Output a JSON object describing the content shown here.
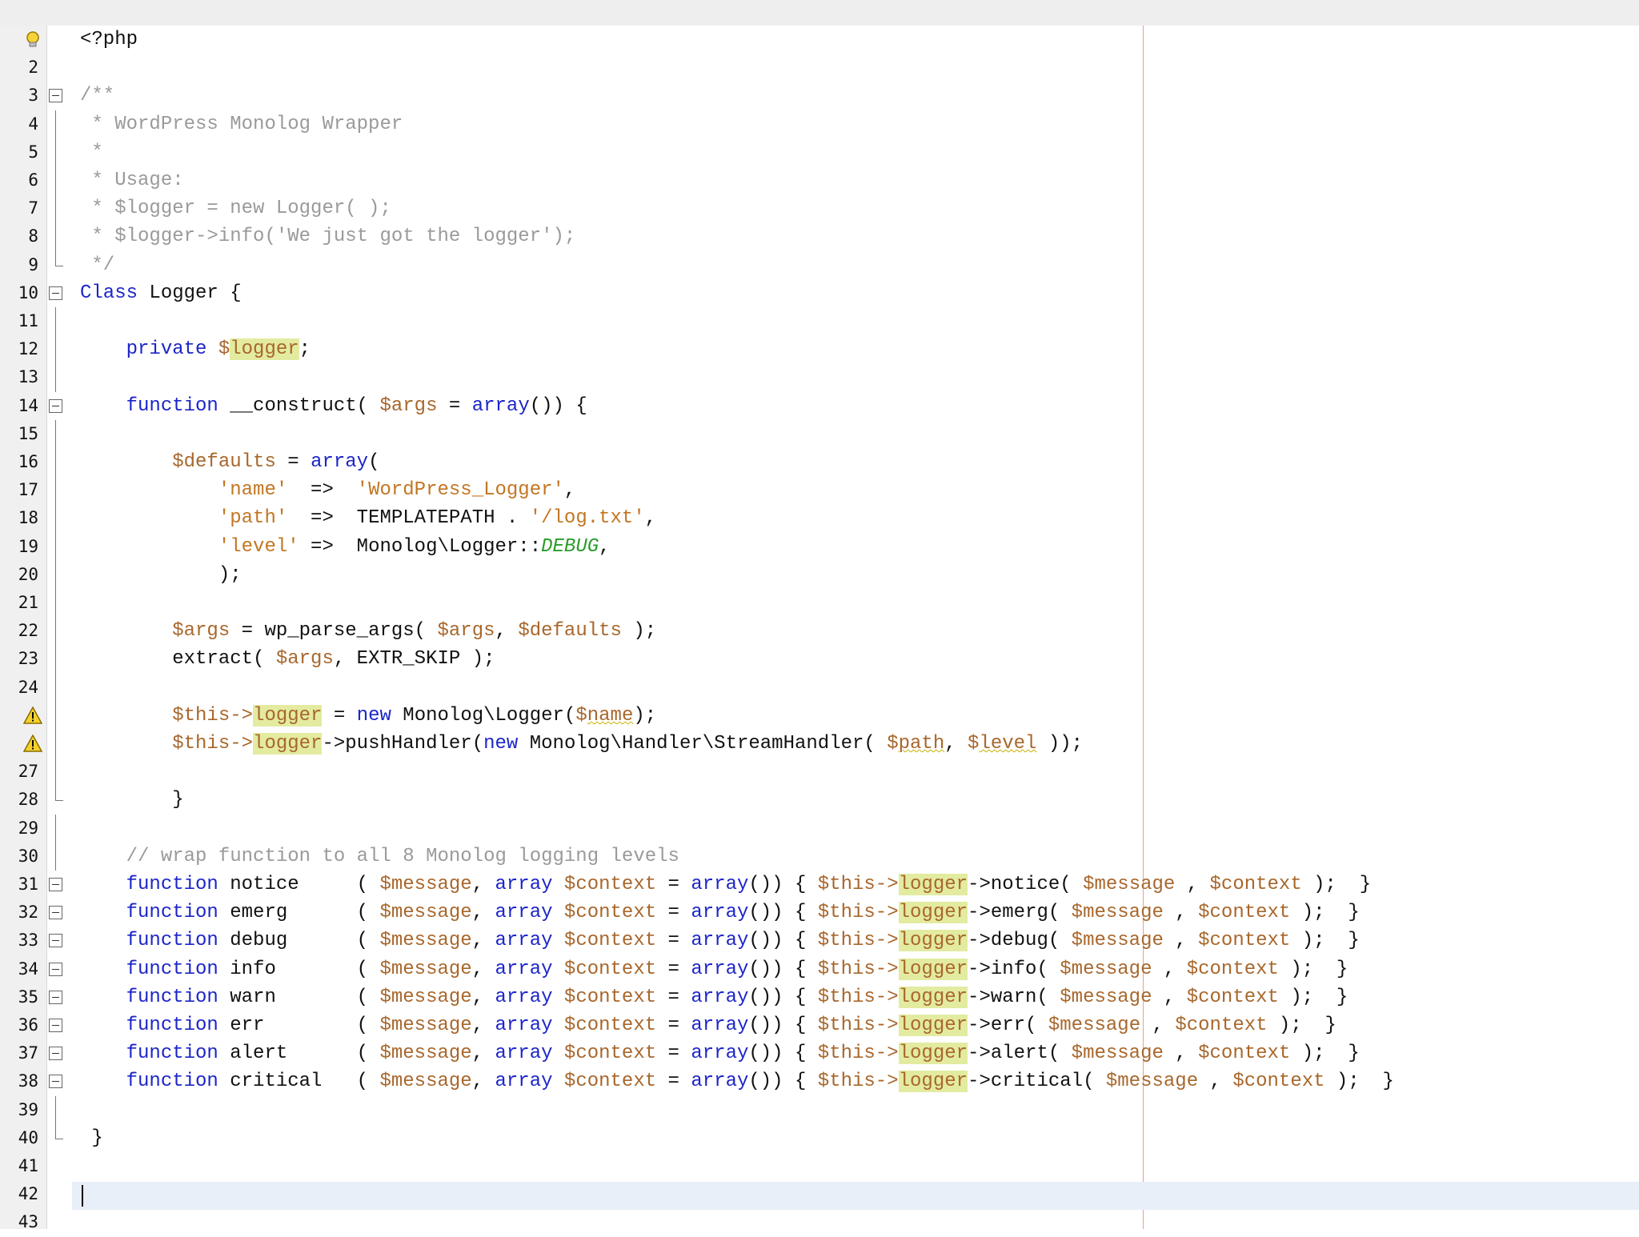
{
  "editor": {
    "colors": {
      "background": "#ffffff",
      "gutter": "#f0f0f0",
      "keyword": "#1c25c8",
      "variable": "#a8672c",
      "string": "#c27622",
      "comment": "#9a9a9a",
      "constant": "#2a9d2a",
      "highlight": "#e3eba0",
      "margin_line": "#f19b8c",
      "current_line": "#e9eff8"
    },
    "lines": [
      {
        "n": "1",
        "icon": "bulb",
        "tokens": [
          [
            "<?php",
            ""
          ]
        ]
      },
      {
        "n": "2",
        "tokens": []
      },
      {
        "n": "3",
        "fold": "start",
        "tokens": [
          [
            "/**",
            "cm"
          ]
        ]
      },
      {
        "n": "4",
        "fold": "line",
        "tokens": [
          [
            " * WordPress Monolog Wrapper",
            "cm"
          ]
        ]
      },
      {
        "n": "5",
        "fold": "line",
        "tokens": [
          [
            " *",
            "cm"
          ]
        ]
      },
      {
        "n": "6",
        "fold": "line",
        "tokens": [
          [
            " * Usage:",
            "cm"
          ]
        ]
      },
      {
        "n": "7",
        "fold": "line",
        "tokens": [
          [
            " * $logger = new Logger( );",
            "cm"
          ]
        ]
      },
      {
        "n": "8",
        "fold": "line",
        "tokens": [
          [
            " * $logger->info('We just got the logger');",
            "cm"
          ]
        ]
      },
      {
        "n": "9",
        "fold": "end",
        "tokens": [
          [
            " */",
            "cm"
          ]
        ]
      },
      {
        "n": "10",
        "fold": "start",
        "tokens": [
          [
            "Class",
            "kw"
          ],
          [
            " Logger {",
            ""
          ]
        ]
      },
      {
        "n": "11",
        "fold": "line",
        "tokens": []
      },
      {
        "n": "12",
        "fold": "line",
        "tokens": [
          [
            "    ",
            ""
          ],
          [
            "private",
            "kw"
          ],
          [
            " ",
            ""
          ],
          [
            "$",
            "var"
          ],
          [
            "logger",
            "var hl"
          ],
          [
            ";",
            ""
          ]
        ]
      },
      {
        "n": "13",
        "fold": "line",
        "tokens": []
      },
      {
        "n": "14",
        "fold": "start",
        "tokens": [
          [
            "    ",
            ""
          ],
          [
            "function",
            "kw"
          ],
          [
            " __construct( ",
            ""
          ],
          [
            "$args",
            "var"
          ],
          [
            " = ",
            ""
          ],
          [
            "array",
            "kw"
          ],
          [
            "()) {",
            ""
          ]
        ]
      },
      {
        "n": "15",
        "fold": "line",
        "tokens": []
      },
      {
        "n": "16",
        "fold": "line",
        "tokens": [
          [
            "        ",
            ""
          ],
          [
            "$defaults",
            "var"
          ],
          [
            " = ",
            ""
          ],
          [
            "array",
            "kw"
          ],
          [
            "(",
            ""
          ]
        ]
      },
      {
        "n": "17",
        "fold": "line",
        "tokens": [
          [
            "            ",
            ""
          ],
          [
            "'name'",
            "str"
          ],
          [
            "  =>  ",
            ""
          ],
          [
            "'WordPress_Logger'",
            "str"
          ],
          [
            ",",
            ""
          ]
        ]
      },
      {
        "n": "18",
        "fold": "line",
        "tokens": [
          [
            "            ",
            ""
          ],
          [
            "'path'",
            "str"
          ],
          [
            "  =>  TEMPLATEPATH . ",
            ""
          ],
          [
            "'/log.txt'",
            "str"
          ],
          [
            ",",
            ""
          ]
        ]
      },
      {
        "n": "19",
        "fold": "line",
        "tokens": [
          [
            "            ",
            ""
          ],
          [
            "'level'",
            "str"
          ],
          [
            " =>  Monolog\\Logger::",
            ""
          ],
          [
            "DEBUG",
            "const-it"
          ],
          [
            ",",
            ""
          ]
        ]
      },
      {
        "n": "20",
        "fold": "line",
        "tokens": [
          [
            "            );",
            ""
          ]
        ]
      },
      {
        "n": "21",
        "fold": "line",
        "tokens": []
      },
      {
        "n": "22",
        "fold": "line",
        "tokens": [
          [
            "        ",
            ""
          ],
          [
            "$args",
            "var"
          ],
          [
            " = wp_parse_args( ",
            ""
          ],
          [
            "$args",
            "var"
          ],
          [
            ", ",
            ""
          ],
          [
            "$defaults",
            "var"
          ],
          [
            " );",
            ""
          ]
        ]
      },
      {
        "n": "23",
        "fold": "line",
        "tokens": [
          [
            "        extract( ",
            ""
          ],
          [
            "$args",
            "var"
          ],
          [
            ", EXTR_SKIP );",
            ""
          ]
        ]
      },
      {
        "n": "24",
        "fold": "line",
        "tokens": []
      },
      {
        "n": "25",
        "icon": "warn",
        "fold": "line",
        "tokens": [
          [
            "        ",
            ""
          ],
          [
            "$this->",
            "var"
          ],
          [
            "logger",
            "var hl"
          ],
          [
            " = ",
            ""
          ],
          [
            "new",
            "kw"
          ],
          [
            " Monolog\\Logger(",
            ""
          ],
          [
            "$",
            "var"
          ],
          [
            "name",
            "var sq"
          ],
          [
            ");",
            ""
          ]
        ]
      },
      {
        "n": "26",
        "icon": "warn",
        "fold": "line",
        "tokens": [
          [
            "        ",
            ""
          ],
          [
            "$this->",
            "var"
          ],
          [
            "logger",
            "var hl"
          ],
          [
            "->pushHandler(",
            ""
          ],
          [
            "new",
            "kw"
          ],
          [
            " Monolog\\Handler\\StreamHandler( ",
            ""
          ],
          [
            "$",
            "var"
          ],
          [
            "path",
            "var sq"
          ],
          [
            ", ",
            ""
          ],
          [
            "$",
            "var"
          ],
          [
            "level",
            "var sq"
          ],
          [
            " ));",
            ""
          ]
        ]
      },
      {
        "n": "27",
        "fold": "line",
        "tokens": []
      },
      {
        "n": "28",
        "fold": "end",
        "tokens": [
          [
            "        }",
            ""
          ]
        ]
      },
      {
        "n": "29",
        "fold": "line",
        "tokens": []
      },
      {
        "n": "30",
        "fold": "line",
        "tokens": [
          [
            "    ",
            ""
          ],
          [
            "// wrap function to all 8 Monolog logging levels",
            "cm"
          ]
        ]
      },
      {
        "n": "31",
        "fold": "start",
        "tokens": [
          [
            "    ",
            ""
          ],
          [
            "function",
            "kw"
          ],
          [
            " notice     ( ",
            ""
          ],
          [
            "$message",
            "var"
          ],
          [
            ", ",
            ""
          ],
          [
            "array",
            "kw"
          ],
          [
            " ",
            ""
          ],
          [
            "$context",
            "var"
          ],
          [
            " = ",
            ""
          ],
          [
            "array",
            "kw"
          ],
          [
            "()) { ",
            ""
          ],
          [
            "$this->",
            "var"
          ],
          [
            "logger",
            "var hl"
          ],
          [
            "->notice( ",
            ""
          ],
          [
            "$message",
            "var"
          ],
          [
            " , ",
            ""
          ],
          [
            "$context",
            "var"
          ],
          [
            " );  }",
            ""
          ]
        ]
      },
      {
        "n": "32",
        "fold": "start",
        "tokens": [
          [
            "    ",
            ""
          ],
          [
            "function",
            "kw"
          ],
          [
            " emerg      ( ",
            ""
          ],
          [
            "$message",
            "var"
          ],
          [
            ", ",
            ""
          ],
          [
            "array",
            "kw"
          ],
          [
            " ",
            ""
          ],
          [
            "$context",
            "var"
          ],
          [
            " = ",
            ""
          ],
          [
            "array",
            "kw"
          ],
          [
            "()) { ",
            ""
          ],
          [
            "$this->",
            "var"
          ],
          [
            "logger",
            "var hl"
          ],
          [
            "->emerg( ",
            ""
          ],
          [
            "$message",
            "var"
          ],
          [
            " , ",
            ""
          ],
          [
            "$context",
            "var"
          ],
          [
            " );  }",
            ""
          ]
        ]
      },
      {
        "n": "33",
        "fold": "start",
        "tokens": [
          [
            "    ",
            ""
          ],
          [
            "function",
            "kw"
          ],
          [
            " debug      ( ",
            ""
          ],
          [
            "$message",
            "var"
          ],
          [
            ", ",
            ""
          ],
          [
            "array",
            "kw"
          ],
          [
            " ",
            ""
          ],
          [
            "$context",
            "var"
          ],
          [
            " = ",
            ""
          ],
          [
            "array",
            "kw"
          ],
          [
            "()) { ",
            ""
          ],
          [
            "$this->",
            "var"
          ],
          [
            "logger",
            "var hl"
          ],
          [
            "->debug( ",
            ""
          ],
          [
            "$message",
            "var"
          ],
          [
            " , ",
            ""
          ],
          [
            "$context",
            "var"
          ],
          [
            " );  }",
            ""
          ]
        ]
      },
      {
        "n": "34",
        "fold": "start",
        "tokens": [
          [
            "    ",
            ""
          ],
          [
            "function",
            "kw"
          ],
          [
            " info       ( ",
            ""
          ],
          [
            "$message",
            "var"
          ],
          [
            ", ",
            ""
          ],
          [
            "array",
            "kw"
          ],
          [
            " ",
            ""
          ],
          [
            "$context",
            "var"
          ],
          [
            " = ",
            ""
          ],
          [
            "array",
            "kw"
          ],
          [
            "()) { ",
            ""
          ],
          [
            "$this->",
            "var"
          ],
          [
            "logger",
            "var hl"
          ],
          [
            "->info( ",
            ""
          ],
          [
            "$message",
            "var"
          ],
          [
            " , ",
            ""
          ],
          [
            "$context",
            "var"
          ],
          [
            " );  }",
            ""
          ]
        ]
      },
      {
        "n": "35",
        "fold": "start",
        "tokens": [
          [
            "    ",
            ""
          ],
          [
            "function",
            "kw"
          ],
          [
            " warn       ( ",
            ""
          ],
          [
            "$message",
            "var"
          ],
          [
            ", ",
            ""
          ],
          [
            "array",
            "kw"
          ],
          [
            " ",
            ""
          ],
          [
            "$context",
            "var"
          ],
          [
            " = ",
            ""
          ],
          [
            "array",
            "kw"
          ],
          [
            "()) { ",
            ""
          ],
          [
            "$this->",
            "var"
          ],
          [
            "logger",
            "var hl"
          ],
          [
            "->warn( ",
            ""
          ],
          [
            "$message",
            "var"
          ],
          [
            " , ",
            ""
          ],
          [
            "$context",
            "var"
          ],
          [
            " );  }",
            ""
          ]
        ]
      },
      {
        "n": "36",
        "fold": "start",
        "tokens": [
          [
            "    ",
            ""
          ],
          [
            "function",
            "kw"
          ],
          [
            " err        ( ",
            ""
          ],
          [
            "$message",
            "var"
          ],
          [
            ", ",
            ""
          ],
          [
            "array",
            "kw"
          ],
          [
            " ",
            ""
          ],
          [
            "$context",
            "var"
          ],
          [
            " = ",
            ""
          ],
          [
            "array",
            "kw"
          ],
          [
            "()) { ",
            ""
          ],
          [
            "$this->",
            "var"
          ],
          [
            "logger",
            "var hl"
          ],
          [
            "->err( ",
            ""
          ],
          [
            "$message",
            "var"
          ],
          [
            " , ",
            ""
          ],
          [
            "$context",
            "var"
          ],
          [
            " );  }",
            ""
          ]
        ]
      },
      {
        "n": "37",
        "fold": "start",
        "tokens": [
          [
            "    ",
            ""
          ],
          [
            "function",
            "kw"
          ],
          [
            " alert      ( ",
            ""
          ],
          [
            "$message",
            "var"
          ],
          [
            ", ",
            ""
          ],
          [
            "array",
            "kw"
          ],
          [
            " ",
            ""
          ],
          [
            "$context",
            "var"
          ],
          [
            " = ",
            ""
          ],
          [
            "array",
            "kw"
          ],
          [
            "()) { ",
            ""
          ],
          [
            "$this->",
            "var"
          ],
          [
            "logger",
            "var hl"
          ],
          [
            "->alert( ",
            ""
          ],
          [
            "$message",
            "var"
          ],
          [
            " , ",
            ""
          ],
          [
            "$context",
            "var"
          ],
          [
            " );  }",
            ""
          ]
        ]
      },
      {
        "n": "38",
        "fold": "start",
        "tokens": [
          [
            "    ",
            ""
          ],
          [
            "function",
            "kw"
          ],
          [
            " critical   ( ",
            ""
          ],
          [
            "$message",
            "var"
          ],
          [
            ", ",
            ""
          ],
          [
            "array",
            "kw"
          ],
          [
            " ",
            ""
          ],
          [
            "$context",
            "var"
          ],
          [
            " = ",
            ""
          ],
          [
            "array",
            "kw"
          ],
          [
            "()) { ",
            ""
          ],
          [
            "$this->",
            "var"
          ],
          [
            "logger",
            "var hl"
          ],
          [
            "->critical( ",
            ""
          ],
          [
            "$message",
            "var"
          ],
          [
            " , ",
            ""
          ],
          [
            "$context",
            "var"
          ],
          [
            " );  }",
            ""
          ]
        ]
      },
      {
        "n": "39",
        "fold": "line",
        "tokens": []
      },
      {
        "n": "40",
        "fold": "end",
        "tokens": [
          [
            " }",
            ""
          ]
        ]
      },
      {
        "n": "41",
        "tokens": []
      },
      {
        "n": "42",
        "tokens": []
      },
      {
        "n": "43",
        "tokens": []
      }
    ]
  }
}
